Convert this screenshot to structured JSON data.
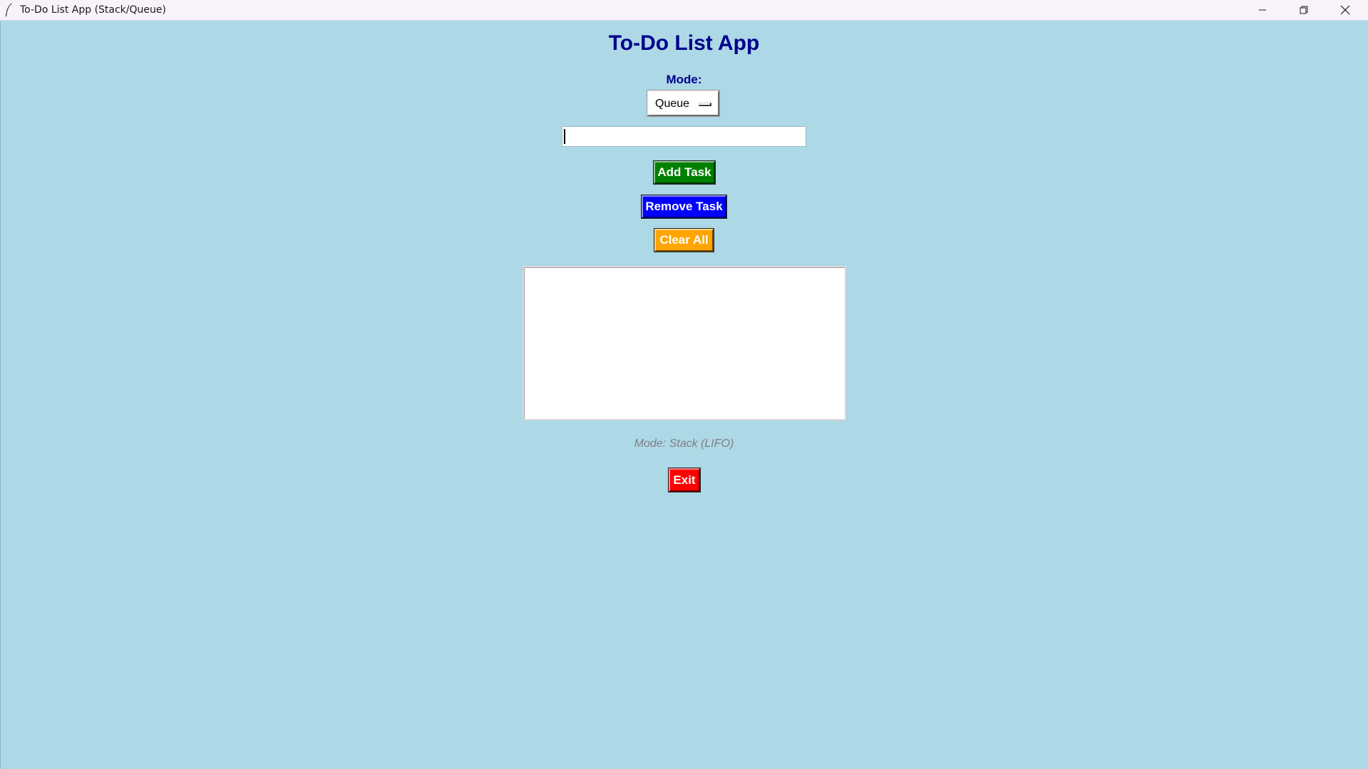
{
  "window": {
    "title": "To-Do List App (Stack/Queue)",
    "controls": {
      "minimize_icon": "minimize-icon",
      "maximize_icon": "restore-icon",
      "close_icon": "close-icon"
    }
  },
  "header": {
    "title": "To-Do List App"
  },
  "mode": {
    "label": "Mode:",
    "selected": "Queue"
  },
  "task_input": {
    "value": "",
    "placeholder": ""
  },
  "buttons": {
    "add": "Add Task",
    "remove": "Remove Task",
    "clear": "Clear All",
    "exit": "Exit"
  },
  "task_list": {
    "items": []
  },
  "status": {
    "text": "Mode: Stack (LIFO)"
  },
  "colors": {
    "background": "#add8e6",
    "heading": "#00008b",
    "add_button": "#008000",
    "remove_button": "#0000ff",
    "clear_button": "#ffa500",
    "exit_button": "#ff0000",
    "status_text": "#808080"
  }
}
